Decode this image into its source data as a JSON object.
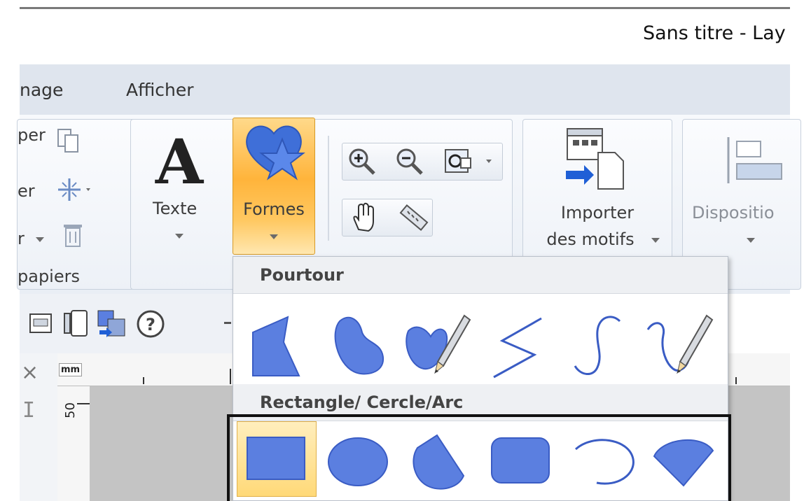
{
  "window": {
    "title": "Sans titre - Lay"
  },
  "tabs": [
    {
      "label": "nage"
    },
    {
      "label": "Afficher"
    }
  ],
  "ribbon": {
    "clipboard": {
      "items": [
        "per",
        "er",
        "r"
      ],
      "group_label": "papiers"
    },
    "texte_label": "Texte",
    "formes_label": "Formes",
    "importer_label_1": "Importer",
    "importer_label_2": "des motifs",
    "disposition_label": "Dispositio"
  },
  "ruler": {
    "unit": "mm",
    "mark": "50"
  },
  "shapes_menu": {
    "section_1": "Pourtour",
    "section_2": "Rectangle/ Cercle/Arc",
    "pourtour_shapes": [
      "polygon-shape",
      "blob-shape",
      "freehand-fill-shape",
      "zigzag-line-shape",
      "curve-line-shape",
      "freehand-line-shape"
    ],
    "rect_shapes": [
      "rectangle-shape",
      "ellipse-shape",
      "sector-shape",
      "rounded-rectangle-shape",
      "arc-shape",
      "chord-shape"
    ]
  },
  "colors": {
    "shape_fill": "#5b7fe0",
    "shape_stroke": "#3a5cc4",
    "accent_orange": "#ffb43b"
  }
}
